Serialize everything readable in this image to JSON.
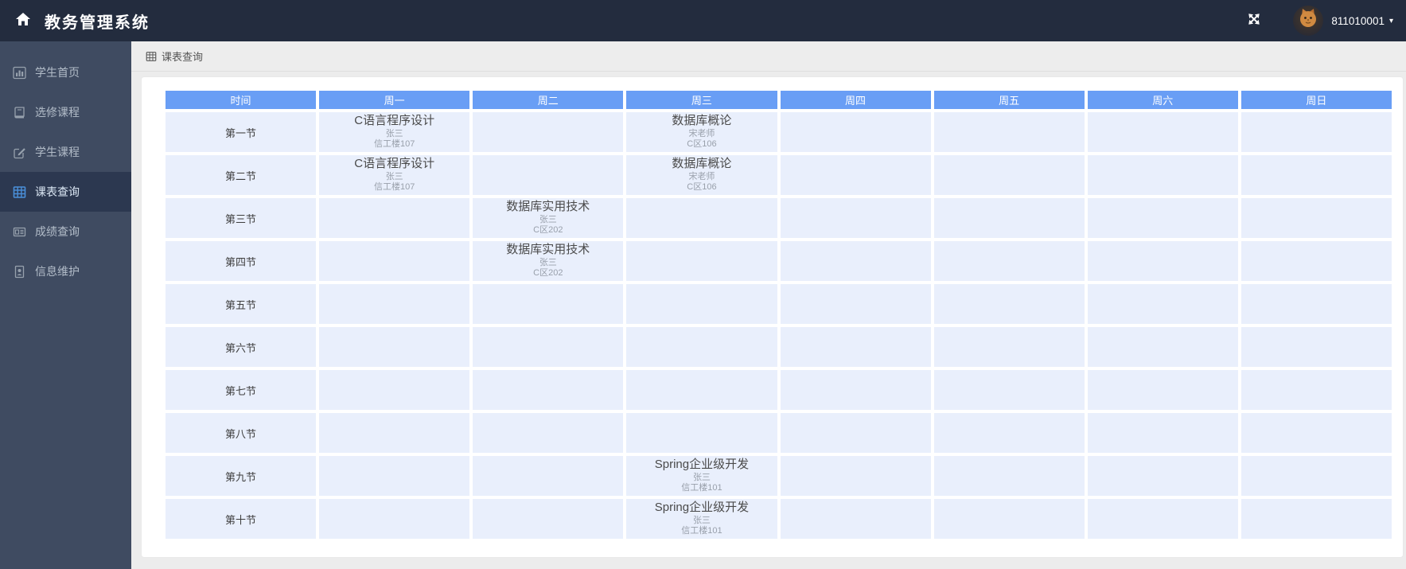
{
  "app": {
    "title": "教务管理系统",
    "user_id": "811010001",
    "caret": "▾"
  },
  "sidebar": {
    "items": [
      {
        "label": "学生首页",
        "icon": "bar-chart-icon",
        "active": false
      },
      {
        "label": "选修课程",
        "icon": "book-icon",
        "active": false
      },
      {
        "label": "学生课程",
        "icon": "edit-icon",
        "active": false
      },
      {
        "label": "课表查询",
        "icon": "table-icon",
        "active": true
      },
      {
        "label": "成绩查询",
        "icon": "id-card-icon",
        "active": false
      },
      {
        "label": "信息维护",
        "icon": "vcard-icon",
        "active": false
      }
    ]
  },
  "breadcrumb": {
    "label": "课表查询"
  },
  "timetable": {
    "columns": [
      "时间",
      "周一",
      "周二",
      "周三",
      "周四",
      "周五",
      "周六",
      "周日"
    ],
    "rows": [
      {
        "time": "第一节",
        "cells": [
          {
            "course": "C语言程序设计",
            "teacher": "张三",
            "room": "信工楼107"
          },
          null,
          {
            "course": "数据库概论",
            "teacher": "宋老师",
            "room": "C区106"
          },
          null,
          null,
          null,
          null
        ]
      },
      {
        "time": "第二节",
        "cells": [
          {
            "course": "C语言程序设计",
            "teacher": "张三",
            "room": "信工楼107"
          },
          null,
          {
            "course": "数据库概论",
            "teacher": "宋老师",
            "room": "C区106"
          },
          null,
          null,
          null,
          null
        ]
      },
      {
        "time": "第三节",
        "cells": [
          null,
          {
            "course": "数据库实用技术",
            "teacher": "张三",
            "room": "C区202"
          },
          null,
          null,
          null,
          null,
          null
        ]
      },
      {
        "time": "第四节",
        "cells": [
          null,
          {
            "course": "数据库实用技术",
            "teacher": "张三",
            "room": "C区202"
          },
          null,
          null,
          null,
          null,
          null
        ]
      },
      {
        "time": "第五节",
        "cells": [
          null,
          null,
          null,
          null,
          null,
          null,
          null
        ]
      },
      {
        "time": "第六节",
        "cells": [
          null,
          null,
          null,
          null,
          null,
          null,
          null
        ]
      },
      {
        "time": "第七节",
        "cells": [
          null,
          null,
          null,
          null,
          null,
          null,
          null
        ]
      },
      {
        "time": "第八节",
        "cells": [
          null,
          null,
          null,
          null,
          null,
          null,
          null
        ]
      },
      {
        "time": "第九节",
        "cells": [
          null,
          null,
          {
            "course": "Spring企业级开发",
            "teacher": "张三",
            "room": "信工楼101"
          },
          null,
          null,
          null,
          null
        ]
      },
      {
        "time": "第十节",
        "cells": [
          null,
          null,
          {
            "course": "Spring企业级开发",
            "teacher": "张三",
            "room": "信工楼101"
          },
          null,
          null,
          null,
          null
        ]
      }
    ]
  },
  "colors": {
    "navbar_bg": "#232c3e",
    "sidebar_bg": "#3f4b61",
    "sidebar_active_bg": "#2c3850",
    "header_blue": "#699ef5",
    "cell_bg": "#e9effc",
    "active_icon": "#4a8fd9",
    "icon_gray": "#97a1ad"
  }
}
